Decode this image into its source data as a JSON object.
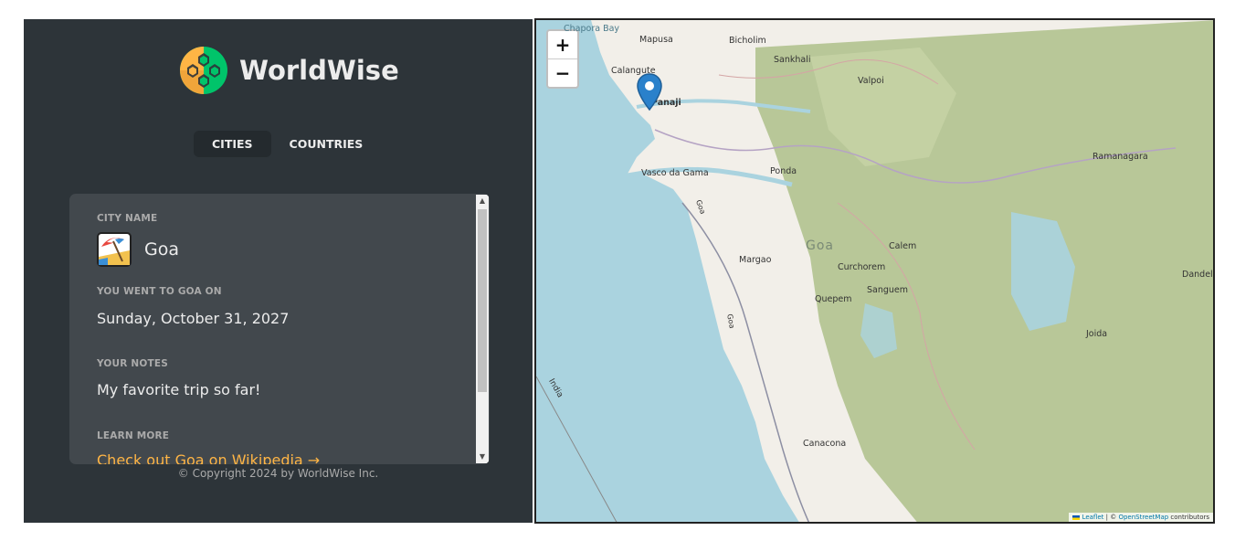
{
  "app": {
    "name": "WorldWise"
  },
  "tabs": [
    {
      "label": "CITIES",
      "active": true
    },
    {
      "label": "COUNTRIES",
      "active": false
    }
  ],
  "city": {
    "name_label": "City name",
    "name": "Goa",
    "flag_icon": "beach-umbrella-emoji",
    "date_label": "You went to Goa on",
    "date": "Sunday, October 31, 2027",
    "notes_label": "Your notes",
    "notes": "My favorite trip so far!",
    "learn_label": "Learn more",
    "learn_link": "Check out Goa on Wikipedia →"
  },
  "footer": {
    "copyright": "© Copyright 2024 by WorldWise Inc."
  },
  "map": {
    "zoom_in": "+",
    "zoom_out": "−",
    "region_label": "Goa",
    "places": [
      "Chapora Bay",
      "Mapusa",
      "Bicholim",
      "Calangute",
      "Sankhali",
      "Valpoi",
      "Panaji",
      "Vasco da Gama",
      "Ponda",
      "Ramanagara",
      "Goa",
      "Calem",
      "Margao",
      "Curchorem",
      "Sanguem",
      "Quepem",
      "Goa",
      "Dandeli",
      "Joida",
      "India",
      "Canacona"
    ],
    "marker": "map-marker-icon",
    "attribution": {
      "leaflet": "Leaflet",
      "sep": " | © ",
      "osm": "OpenStreetMap",
      "suffix": " contributors"
    }
  },
  "colors": {
    "sidebar": "#2d3439",
    "card": "#42484d",
    "accent": "#ffb545",
    "sea": "#aad3df",
    "forest": "#aebf8a",
    "land": "#f2efe9"
  }
}
